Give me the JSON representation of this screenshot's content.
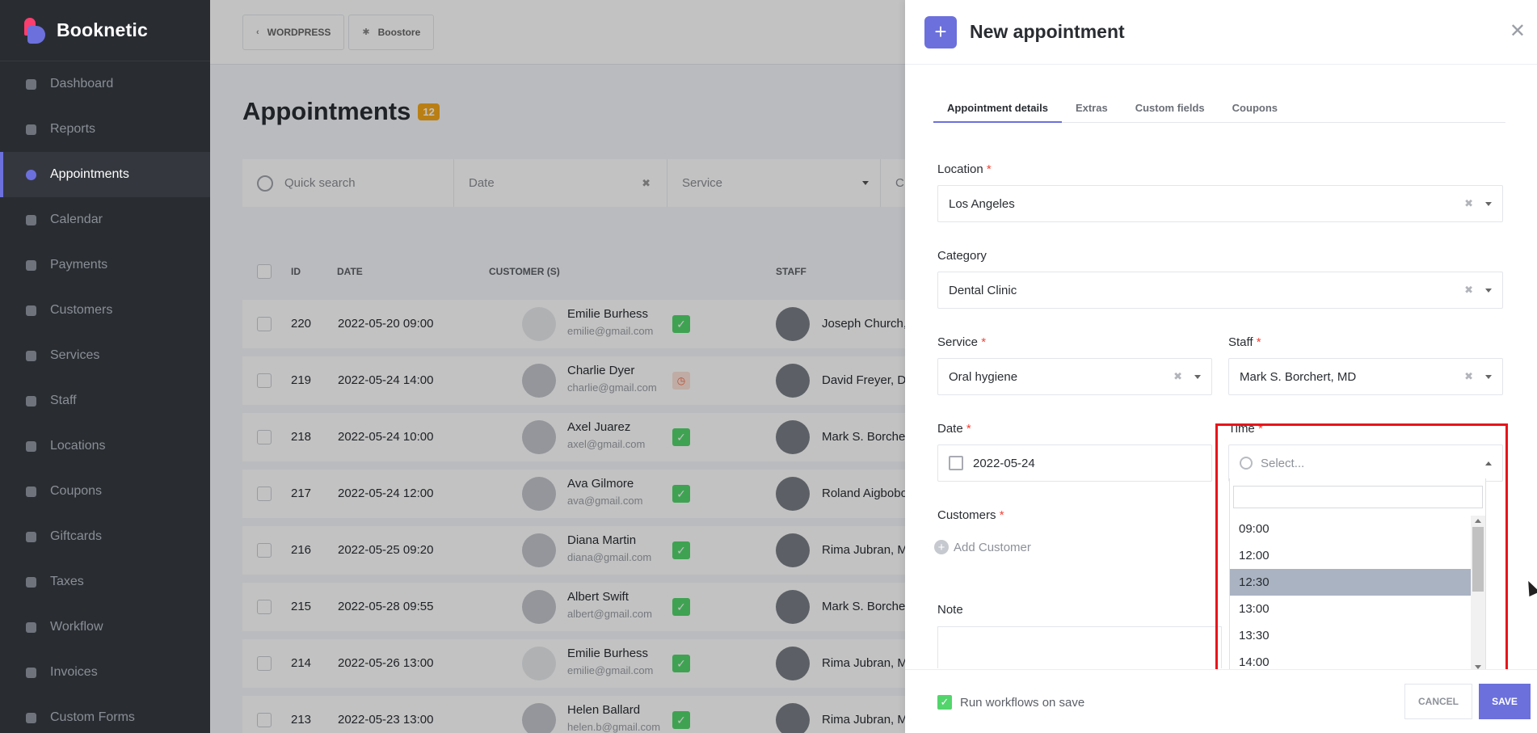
{
  "brand": {
    "name": "Booknetic"
  },
  "sidebar": {
    "items": [
      {
        "label": "Dashboard",
        "icon": "cube-icon",
        "active": false
      },
      {
        "label": "Reports",
        "icon": "chart-icon",
        "active": false
      },
      {
        "label": "Appointments",
        "icon": "clock-icon",
        "active": true
      },
      {
        "label": "Calendar",
        "icon": "calendar-icon",
        "active": false
      },
      {
        "label": "Payments",
        "icon": "wallet-icon",
        "active": false
      },
      {
        "label": "Customers",
        "icon": "users-icon",
        "active": false
      },
      {
        "label": "Services",
        "icon": "list-icon",
        "active": false
      },
      {
        "label": "Staff",
        "icon": "user-icon",
        "active": false
      },
      {
        "label": "Locations",
        "icon": "location-arrow-icon",
        "active": false
      },
      {
        "label": "Coupons",
        "icon": "tag-icon",
        "active": false
      },
      {
        "label": "Giftcards",
        "icon": "gift-icon",
        "active": false
      },
      {
        "label": "Taxes",
        "icon": "percent-icon",
        "active": false
      },
      {
        "label": "Workflow",
        "icon": "workflow-icon",
        "active": false
      },
      {
        "label": "Invoices",
        "icon": "file-icon",
        "active": false
      },
      {
        "label": "Custom Forms",
        "icon": "form-icon",
        "active": false
      }
    ]
  },
  "topbar": {
    "wordpress": "WORDPRESS",
    "boostore": "Boostore"
  },
  "page": {
    "title": "Appointments",
    "count": "12"
  },
  "filters": {
    "search_placeholder": "Quick search",
    "date_placeholder": "Date",
    "service_placeholder": "Service",
    "extra": "C"
  },
  "table": {
    "headers": {
      "id": "ID",
      "date": "DATE",
      "customer": "CUSTOMER (S)",
      "staff": "STAFF"
    },
    "rows": [
      {
        "id": "220",
        "date": "2022-05-20 09:00",
        "customer": "Emilie Burhess",
        "email": "emilie@gmail.com",
        "status": "ok",
        "staff": "Joseph Church, MD"
      },
      {
        "id": "219",
        "date": "2022-05-24 14:00",
        "customer": "Charlie Dyer",
        "email": "charlie@gmail.com",
        "status": "pending",
        "staff": "David Freyer, DO"
      },
      {
        "id": "218",
        "date": "2022-05-24 10:00",
        "customer": "Axel Juarez",
        "email": "axel@gmail.com",
        "status": "ok",
        "staff": "Mark S. Borchert, MD"
      },
      {
        "id": "217",
        "date": "2022-05-24 12:00",
        "customer": "Ava Gilmore",
        "email": "ava@gmail.com",
        "status": "ok",
        "staff": "Roland Aigbobo"
      },
      {
        "id": "216",
        "date": "2022-05-25 09:20",
        "customer": "Diana Martin",
        "email": "diana@gmail.com",
        "status": "ok",
        "staff": "Rima Jubran, MD"
      },
      {
        "id": "215",
        "date": "2022-05-28 09:55",
        "customer": "Albert Swift",
        "email": "albert@gmail.com",
        "status": "ok",
        "staff": "Mark S. Borchert, MD"
      },
      {
        "id": "214",
        "date": "2022-05-26 13:00",
        "customer": "Emilie Burhess",
        "email": "emilie@gmail.com",
        "status": "ok",
        "staff": "Rima Jubran, MD"
      },
      {
        "id": "213",
        "date": "2022-05-23 13:00",
        "customer": "Helen Ballard",
        "email": "helen.b@gmail.com",
        "status": "ok",
        "staff": "Rima Jubran, MD"
      }
    ]
  },
  "panel": {
    "title": "New appointment",
    "tabs": [
      "Appointment details",
      "Extras",
      "Custom fields",
      "Coupons"
    ],
    "location": {
      "label": "Location",
      "value": "Los Angeles"
    },
    "category": {
      "label": "Category",
      "value": "Dental Clinic"
    },
    "service": {
      "label": "Service",
      "value": "Oral hygiene"
    },
    "staff": {
      "label": "Staff",
      "value": "Mark S. Borchert, MD"
    },
    "date": {
      "label": "Date",
      "value": "2022-05-24"
    },
    "time": {
      "label": "Time",
      "placeholder": "Select...",
      "options": [
        "09:00",
        "12:00",
        "12:30",
        "13:00",
        "13:30",
        "14:00"
      ],
      "selected": "12:30"
    },
    "customers": {
      "label": "Customers",
      "add": "Add Customer"
    },
    "note": {
      "label": "Note"
    },
    "required_mark": "*"
  },
  "footer": {
    "workflow_label": "Run workflows on save",
    "cancel": "CANCEL",
    "save": "SAVE"
  },
  "colors": {
    "accent": "#6c70dc",
    "success": "#53d56c",
    "highlight": "#e8141b",
    "sidebar": "#292d32"
  }
}
